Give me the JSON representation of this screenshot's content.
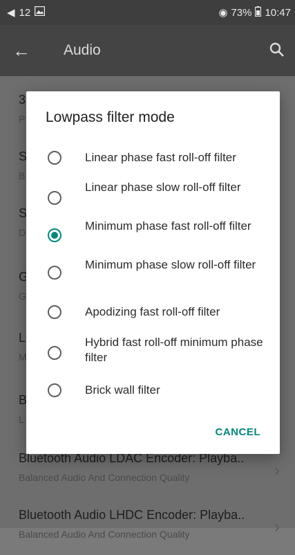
{
  "status_bar": {
    "notification_count": "12",
    "battery": "73%",
    "time": "10:47"
  },
  "app_bar": {
    "title": "Audio"
  },
  "list": {
    "rows": [
      {
        "title": "3",
        "subtitle": "P"
      },
      {
        "title": "S",
        "subtitle": "B"
      },
      {
        "title": "S",
        "subtitle": "D"
      },
      {
        "title": "G",
        "subtitle": "G"
      },
      {
        "title": "L",
        "subtitle": "M"
      },
      {
        "title": "B",
        "subtitle": "L"
      },
      {
        "title": "Bluetooth Audio LDAC Encoder: Playba..",
        "subtitle": "Balanced Audio And Connection Quality"
      },
      {
        "title": "Bluetooth Audio LHDC Encoder: Playba..",
        "subtitle": "Balanced Audio And Connection Quality"
      }
    ]
  },
  "dialog": {
    "title": "Lowpass filter mode",
    "options": [
      {
        "label": "Linear phase fast roll-off filter",
        "checked": false
      },
      {
        "label": "Linear phase slow roll-off filter",
        "checked": false
      },
      {
        "label": "Minimum phase fast roll-off filter",
        "checked": true
      },
      {
        "label": "Minimum phase slow roll-off filter",
        "checked": false
      },
      {
        "label": "Apodizing fast roll-off filter",
        "checked": false
      },
      {
        "label": "Hybrid fast roll-off minimum phase filter",
        "checked": false
      },
      {
        "label": "Brick wall filter",
        "checked": false
      }
    ],
    "cancel_label": "CANCEL"
  },
  "colors": {
    "accent": "#00897b"
  }
}
